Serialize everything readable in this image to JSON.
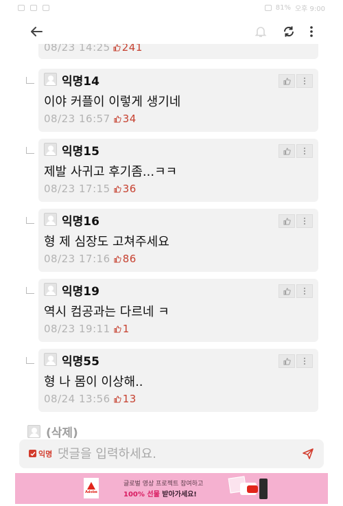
{
  "status_bar": {
    "battery": "81%",
    "time": "오후 9:00"
  },
  "previous_meta": {
    "date": "08/23 14:25",
    "likes": "241"
  },
  "comments": [
    {
      "author": "익명14",
      "text": "이야 커플이 이렇게 생기네",
      "date": "08/23 16:57",
      "likes": "34"
    },
    {
      "author": "익명15",
      "text": "제발 사귀고 후기좀...ㅋㅋ",
      "date": "08/23 17:15",
      "likes": "36"
    },
    {
      "author": "익명16",
      "text": "형 제 심장도 고쳐주세요",
      "date": "08/23 17:16",
      "likes": "86"
    },
    {
      "author": "익명19",
      "text": "역시 컴공과는 다르네 ㅋ",
      "date": "08/23 19:11",
      "likes": "1"
    },
    {
      "author": "익명55",
      "text": "형 나 몸이 이상해..",
      "date": "08/24 13:56",
      "likes": "13"
    }
  ],
  "deleted_comment": {
    "label": "(삭제)"
  },
  "input": {
    "anonymous_label": "익명",
    "placeholder": "댓글을 입력하세요."
  },
  "ad": {
    "brand": "Adobe",
    "line1": "글로벌 영상 프로젝트 참여하고",
    "line2_prefix": "100% 선물",
    "line2_suffix": " 받아가세요!"
  },
  "icons": {
    "back": "arrow-left-icon",
    "notifications": "bell-off-icon",
    "refresh": "refresh-icon",
    "more": "more-vertical-icon",
    "like": "thumbs-up-icon",
    "send": "send-icon"
  },
  "colors": {
    "like_count": "#c6402f",
    "anonymous": "#d23b2c",
    "card_background": "#f2f2f2",
    "ad_background": "#f5b1d0"
  }
}
